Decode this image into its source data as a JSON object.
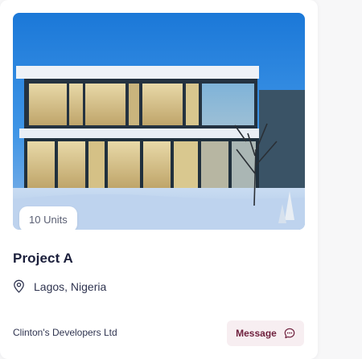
{
  "listing": {
    "image_alt": "Modern two-storey glass house at dusk",
    "units_badge": "10 Units",
    "title": "Project A",
    "location": "Lagos, Nigeria",
    "developer": "Clinton's Developers Ltd",
    "message_label": "Message"
  },
  "icons": {
    "location": "map-pin-icon",
    "message": "chat-bubble-icon"
  },
  "colors": {
    "title": "#1b1f3b",
    "text": "#2f3450",
    "button_bg": "#f7eef1",
    "button_text": "#6e1f3c"
  }
}
